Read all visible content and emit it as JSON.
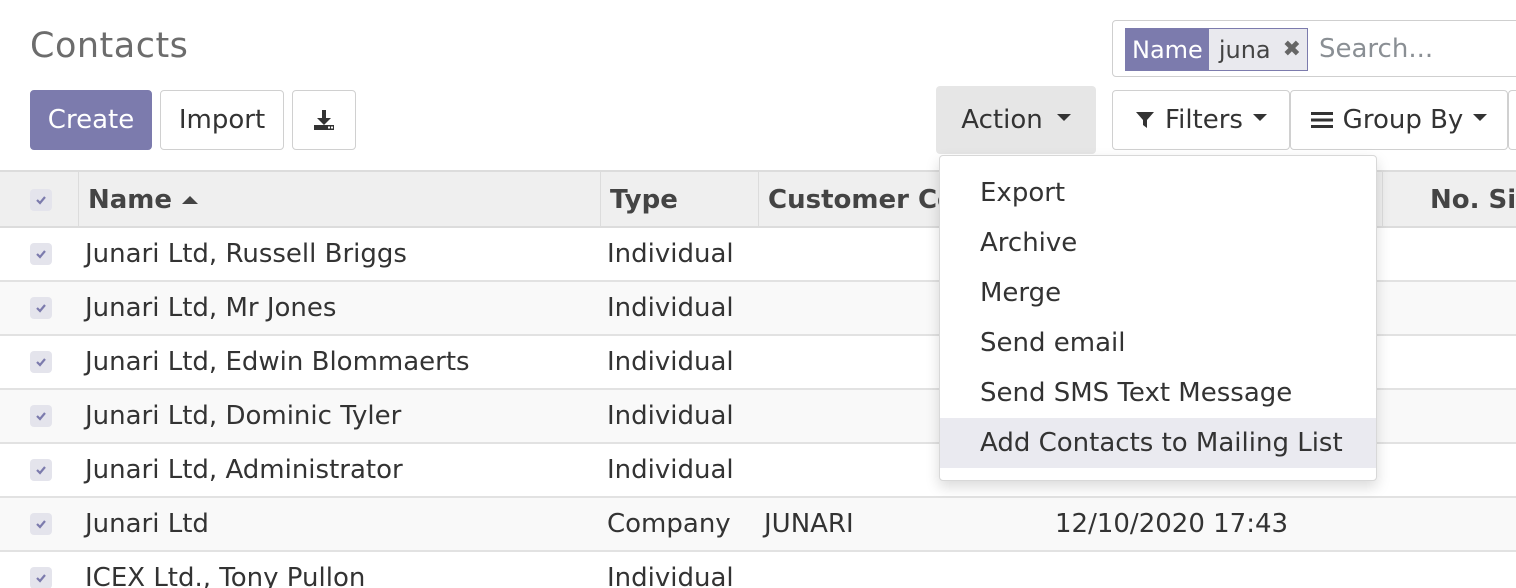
{
  "page": {
    "title": "Contacts"
  },
  "toolbar": {
    "create_label": "Create",
    "import_label": "Import",
    "action_label": "Action",
    "filters_label": "Filters",
    "groupby_label": "Group By"
  },
  "search": {
    "facet_name": "Name",
    "facet_value": "juna",
    "placeholder": "Search..."
  },
  "table": {
    "columns": {
      "name": "Name",
      "type": "Type",
      "customer_code": "Customer Co",
      "no_sites": "No. Sit"
    },
    "rows": [
      {
        "name": "Junari Ltd, Russell Briggs",
        "type": "Individual",
        "customer_code": "",
        "date": ""
      },
      {
        "name": "Junari Ltd, Mr Jones",
        "type": "Individual",
        "customer_code": "",
        "date": ""
      },
      {
        "name": "Junari Ltd, Edwin Blommaerts",
        "type": "Individual",
        "customer_code": "",
        "date": ""
      },
      {
        "name": "Junari Ltd, Dominic Tyler",
        "type": "Individual",
        "customer_code": "",
        "date": ""
      },
      {
        "name": "Junari Ltd, Administrator",
        "type": "Individual",
        "customer_code": "",
        "date": ""
      },
      {
        "name": "Junari Ltd",
        "type": "Company",
        "customer_code": "JUNARI",
        "date": "12/10/2020 17:43"
      },
      {
        "name": "ICEX Ltd., Tony Pullon",
        "type": "Individual",
        "customer_code": "",
        "date": ""
      }
    ]
  },
  "action_menu": {
    "items": [
      "Export",
      "Archive",
      "Merge",
      "Send email",
      "Send SMS Text Message",
      "Add Contacts to Mailing List"
    ]
  },
  "colors": {
    "primary": "#7c7bad",
    "header_bg": "#efefef",
    "active_item_bg": "#eaeaf0"
  }
}
